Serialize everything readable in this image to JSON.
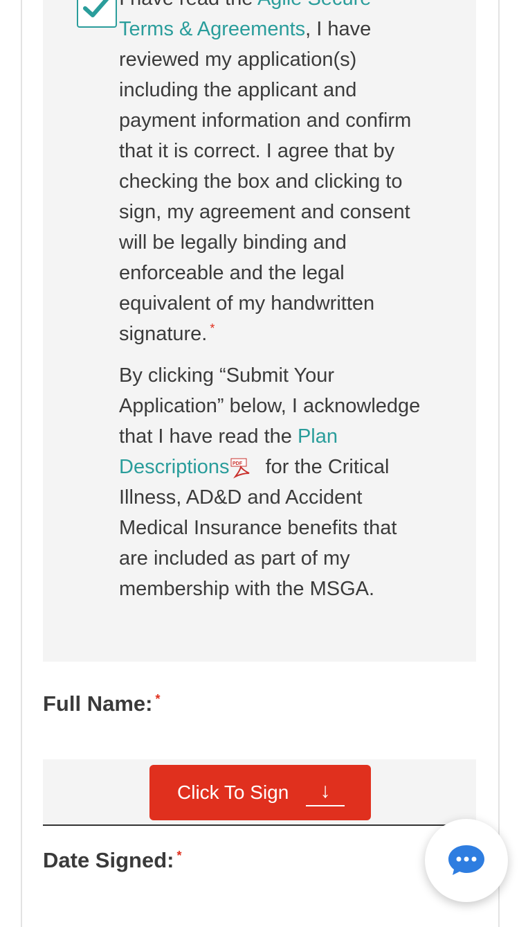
{
  "consent": {
    "checked": true,
    "para1_prefix": "I have read the ",
    "terms_link": "Agile Secure Terms & Agreements",
    "para1_body": ", I have reviewed my application(s) including the applicant and payment information and confirm that it is correct. I agree that by checking the box and clicking to sign, my agreement and consent will be legally binding and enforceable and the legal equivalent of my handwritten signature.",
    "required_mark": "*",
    "para2_prefix": "By clicking “Submit Your Application” below, I acknowledge that I have read the ",
    "plan_link": "Plan Descriptions",
    "para2_suffix": "for the Critical Illness, AD&D and Accident Medical Insurance benefits that are included as part of my membership with the MSGA."
  },
  "full_name": {
    "label": "Full Name:",
    "required_mark": "*",
    "sign_button": "Click To Sign",
    "sign_arrow": "↓"
  },
  "date_signed": {
    "label": "Date Signed:",
    "required_mark": "*"
  },
  "colors": {
    "accent": "#2a9d9b",
    "button": "#e0301e",
    "panel": "#f4f4f4"
  },
  "icons": {
    "checkbox": "check-icon",
    "pdf": "pdf-icon",
    "chat": "chat-bubble-icon"
  }
}
